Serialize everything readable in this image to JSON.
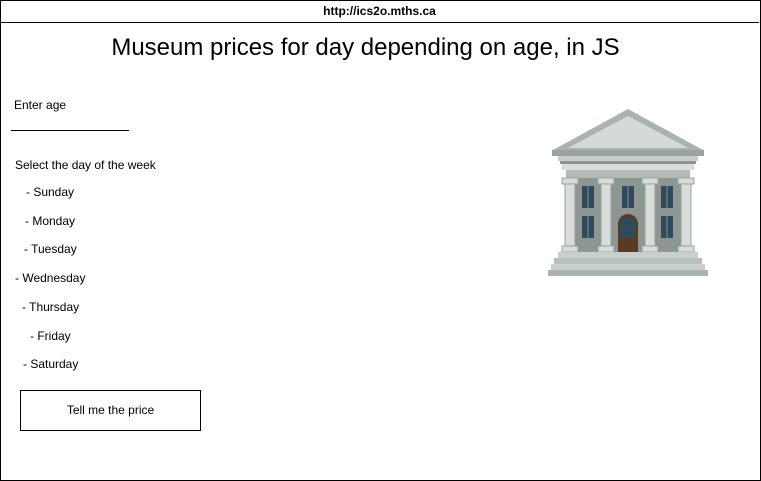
{
  "browser": {
    "url": "http://ics2o.mths.ca"
  },
  "page": {
    "title": "Museum prices for day depending on age, in JS"
  },
  "form": {
    "age_label": "Enter age",
    "age_value": "",
    "day_prompt": "Select the day of the week",
    "days": [
      "- Sunday",
      "- Monday",
      "- Tuesday",
      "- Wednesday",
      "- Thursday",
      "- Friday",
      "- Saturday"
    ],
    "button_label": "Tell me the price"
  },
  "image": {
    "icon": "museum-building-icon",
    "colors": {
      "roof": "#b9c2bd",
      "column": "#d8ddd9",
      "wall": "#8e9692",
      "window": "#2f4a5a",
      "door": "#5a3a22"
    }
  }
}
